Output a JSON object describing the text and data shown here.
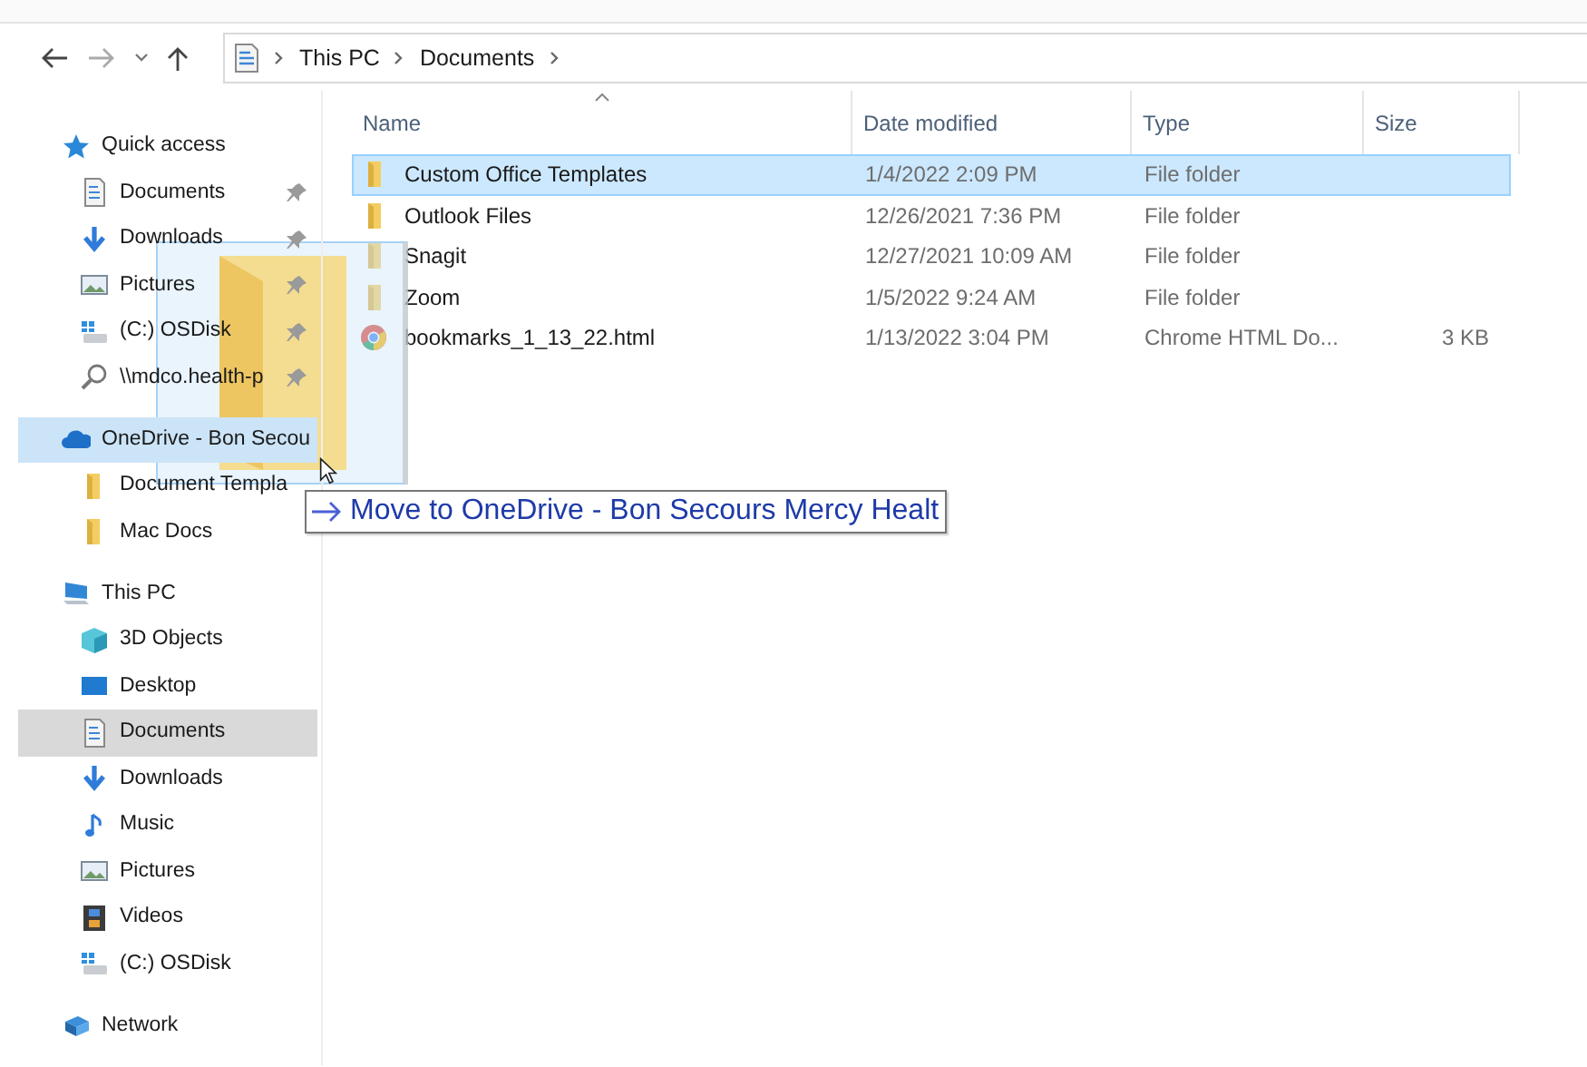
{
  "address_bar": {
    "crumbs": [
      "This PC",
      "Documents"
    ]
  },
  "sidebar": {
    "groups": [
      {
        "label": "Quick access",
        "kind": "star",
        "selected": false,
        "drop_target": false,
        "children": [
          {
            "label": "Documents",
            "kind": "documents",
            "selected": false,
            "drop_target": false,
            "pinned": true
          },
          {
            "label": "Downloads",
            "kind": "downloads",
            "selected": false,
            "drop_target": false,
            "pinned": true
          },
          {
            "label": "Pictures",
            "kind": "pictures",
            "selected": false,
            "drop_target": false,
            "pinned": true
          },
          {
            "label": "(C:) OSDisk",
            "kind": "drive",
            "selected": false,
            "drop_target": false,
            "pinned": true
          },
          {
            "label": "\\\\mdco.health-p",
            "kind": "share",
            "selected": false,
            "drop_target": false,
            "pinned": true
          }
        ]
      },
      {
        "label": "OneDrive - Bon Secou",
        "kind": "cloud",
        "selected": false,
        "drop_target": true,
        "children": [
          {
            "label": "Document Templa",
            "kind": "folder",
            "selected": false,
            "drop_target": false,
            "pinned": false
          },
          {
            "label": "Mac Docs",
            "kind": "folder",
            "selected": false,
            "drop_target": false,
            "pinned": false
          }
        ]
      },
      {
        "label": "This PC",
        "kind": "pc",
        "selected": false,
        "drop_target": false,
        "children": [
          {
            "label": "3D Objects",
            "kind": "cube",
            "selected": false,
            "drop_target": false,
            "pinned": false
          },
          {
            "label": "Desktop",
            "kind": "desktop",
            "selected": false,
            "drop_target": false,
            "pinned": false
          },
          {
            "label": "Documents",
            "kind": "documents",
            "selected": true,
            "drop_target": false,
            "pinned": false
          },
          {
            "label": "Downloads",
            "kind": "downloads",
            "selected": false,
            "drop_target": false,
            "pinned": false
          },
          {
            "label": "Music",
            "kind": "music",
            "selected": false,
            "drop_target": false,
            "pinned": false
          },
          {
            "label": "Pictures",
            "kind": "pictures",
            "selected": false,
            "drop_target": false,
            "pinned": false
          },
          {
            "label": "Videos",
            "kind": "videos",
            "selected": false,
            "drop_target": false,
            "pinned": false
          },
          {
            "label": "(C:) OSDisk",
            "kind": "drive",
            "selected": false,
            "drop_target": false,
            "pinned": false
          }
        ]
      },
      {
        "label": "Network",
        "kind": "network",
        "selected": false,
        "drop_target": false
      }
    ]
  },
  "file_list": {
    "columns": [
      {
        "label": "Name",
        "sorted": true
      },
      {
        "label": "Date modified",
        "sorted": false
      },
      {
        "label": "Type",
        "sorted": false
      },
      {
        "label": "Size",
        "sorted": false
      }
    ],
    "rows": [
      {
        "name": "Custom Office Templates",
        "date": "1/4/2022 2:09 PM",
        "type": "File folder",
        "kind": "folder",
        "selected": true
      },
      {
        "name": "Outlook Files",
        "date": "12/26/2021 7:36 PM",
        "type": "File folder",
        "kind": "folder",
        "selected": false
      },
      {
        "name": "Snagit",
        "date": "12/27/2021 10:09 AM",
        "type": "File folder",
        "kind": "folder",
        "selected": false
      },
      {
        "name": "Zoom",
        "date": "1/5/2022 9:24 AM",
        "type": "File folder",
        "kind": "folder",
        "selected": false
      },
      {
        "name": "bookmarks_1_13_22.html",
        "date": "1/13/2022 3:04 PM",
        "type": "Chrome HTML Do...",
        "size": "3 KB",
        "kind": "web",
        "selected": false
      }
    ]
  },
  "drag_tooltip": {
    "text": "Move to OneDrive - Bon Secours Mercy Healt"
  }
}
